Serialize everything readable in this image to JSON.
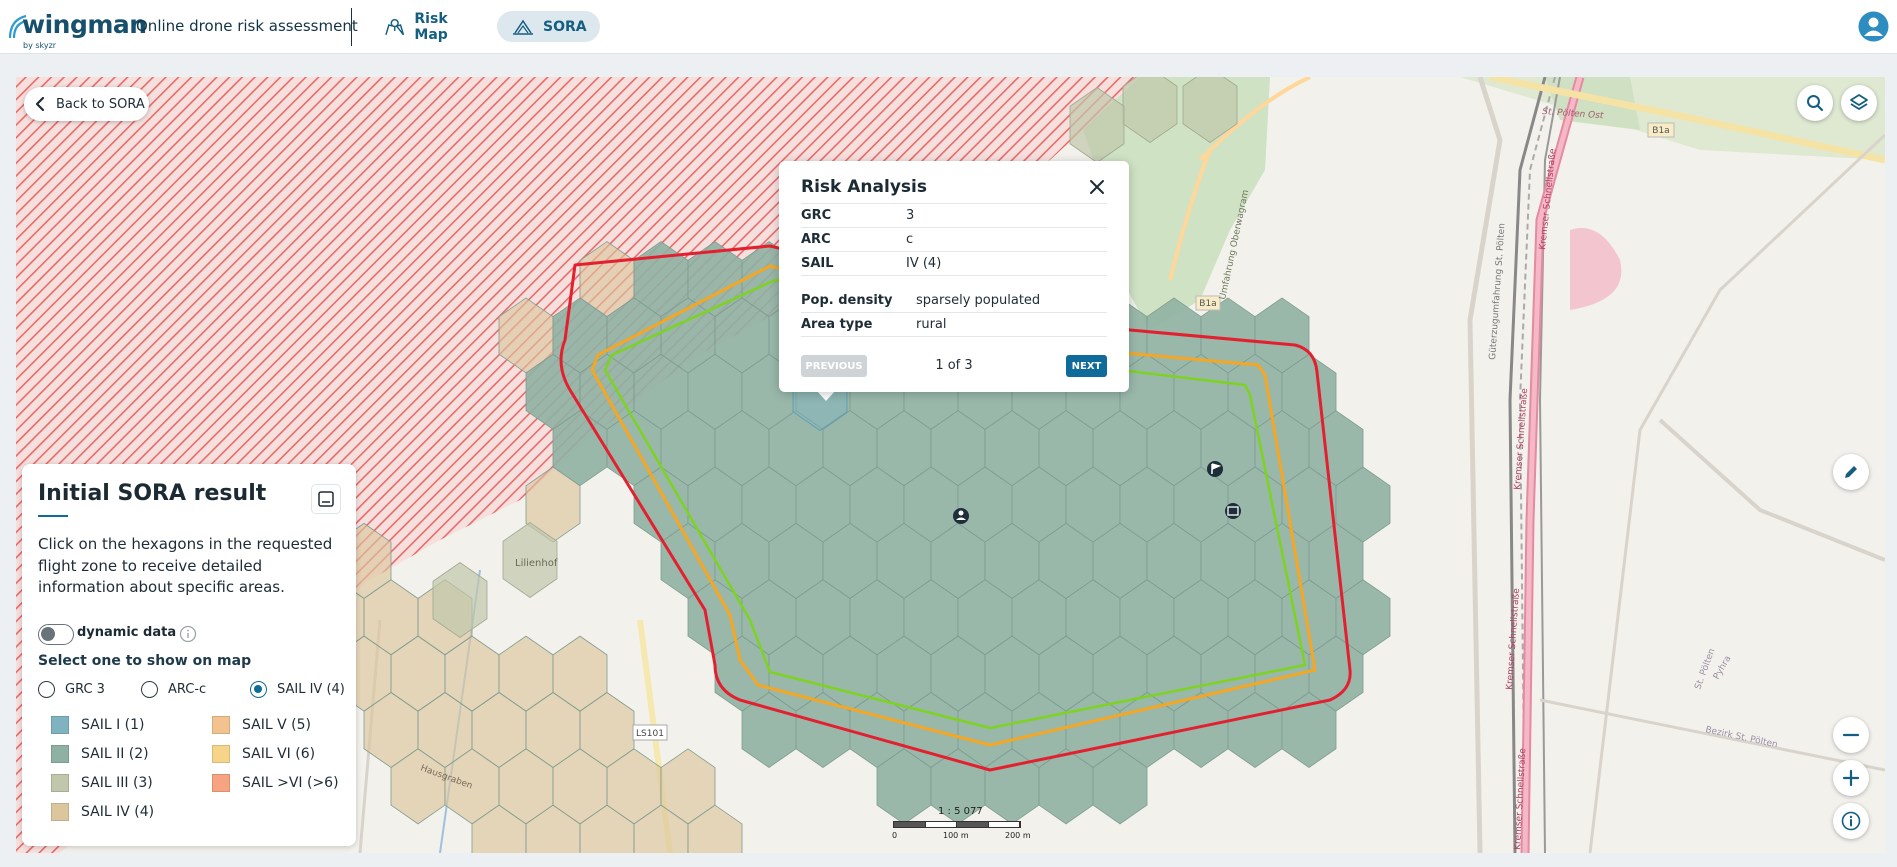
{
  "header": {
    "logo_text": "wingman",
    "logo_sub": "by skyzr",
    "app_title": "Online drone risk assessment",
    "tabs": [
      {
        "label": "Risk Map",
        "active": false
      },
      {
        "label": "SORA",
        "active": true
      }
    ]
  },
  "map": {
    "back_label": "Back to SORA",
    "place_labels": {
      "lilienhof": "Lilienhof",
      "road_ls101": "LS101",
      "b1a": "B1a",
      "b1a_2": "B1a",
      "st_poelten_ost": "St. Pölten Ost",
      "raststation": "Raststation St. Pölten Ost",
      "kremser_1": "Kremser Schnellstraße",
      "kremser_2": "Kremser Schnellstraße",
      "kremser_3": "Kremser Schnellstraße",
      "kremser_4": "Kremser Schnellstraße",
      "bezirk": "Bezirk St. Pölten",
      "pyhra": "Pyhra",
      "oberwagram": "Umfahrung Oberwagram",
      "gueterzug": "Güterzugumfahrung St. Pölten",
      "st_poelten": "St. Pölten",
      "hausgraben": "Hausgraben"
    },
    "scale": {
      "ratio": "1 : 5 077",
      "labels": [
        "0",
        "100 m",
        "200 m"
      ]
    }
  },
  "popup": {
    "title": "Risk Analysis",
    "rows_top": [
      {
        "key": "GRC",
        "value": "3"
      },
      {
        "key": "ARC",
        "value": "c"
      },
      {
        "key": "SAIL",
        "value": "IV (4)"
      }
    ],
    "rows_bottom": [
      {
        "key": "Pop. density",
        "value": "sparsely populated"
      },
      {
        "key": "Area type",
        "value": "rural"
      }
    ],
    "previous_label": "PREVIOUS",
    "next_label": "NEXT",
    "page_text": "1 of 3"
  },
  "sora_panel": {
    "title": "Initial SORA result",
    "description": "Click on the hexagons in the requested flight zone to receive detailed information about specific areas.",
    "toggle_label": "dynamic data",
    "toggle_on": false,
    "select_label": "Select one to show on map",
    "radios": [
      {
        "label": "GRC 3",
        "selected": false
      },
      {
        "label": "ARC-c",
        "selected": false
      },
      {
        "label": "SAIL IV (4)",
        "selected": true
      }
    ],
    "legend": [
      {
        "label": "SAIL I (1)",
        "color": "#7fb3c2"
      },
      {
        "label": "SAIL II (2)",
        "color": "#8fb1a3"
      },
      {
        "label": "SAIL III (3)",
        "color": "#c0c7ab"
      },
      {
        "label": "SAIL IV (4)",
        "color": "#dcc69e"
      },
      {
        "label": "SAIL V (5)",
        "color": "#f2c38f"
      },
      {
        "label": "SAIL VI (6)",
        "color": "#f6d48a"
      },
      {
        "label": "SAIL >VI (>6)",
        "color": "#f7a382"
      }
    ]
  },
  "colors": {
    "accent": "#0f6b9a",
    "brand": "#16506d",
    "flight_zone_red": "#e3202f",
    "flight_zone_orange": "#f5a623",
    "flight_zone_green": "#7ed321"
  }
}
